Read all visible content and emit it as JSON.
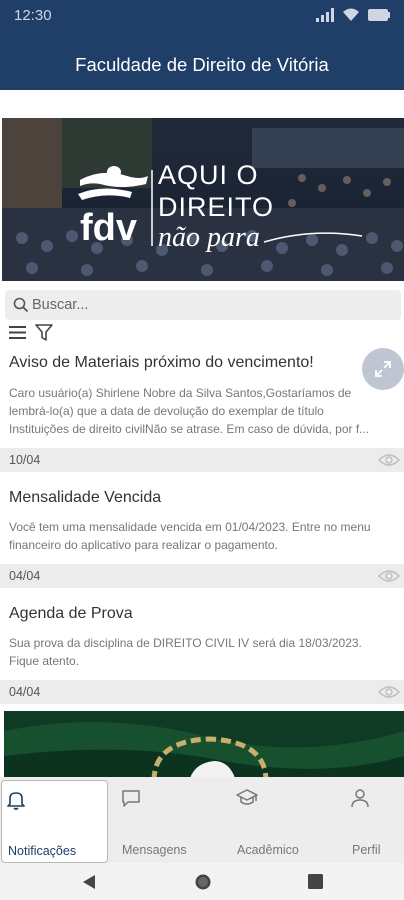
{
  "status": {
    "time": "12:30"
  },
  "app": {
    "title": "Faculdade de Direito de Vitória"
  },
  "banner": {
    "brand": "fdv",
    "slogan_line1": "AQUI O",
    "slogan_line2": "DIREITO",
    "slogan_line3": "não para"
  },
  "search": {
    "placeholder": "Buscar..."
  },
  "notifications": [
    {
      "title": "Aviso de Materiais próximo do vencimento!",
      "body": "Caro usuário(a) Shirlene Nobre da Silva Santos,Gostaríamos de lembrá-lo(a) que a data de devolução do exemplar de título Instituições de direito civilNão se atrase. Em caso de dúvida, por f...",
      "date": "10/04"
    },
    {
      "title": "Mensalidade Vencida",
      "body": "Você tem uma mensalidade vencida em 01/04/2023. Entre no menu financeiro do aplicativo para realizar o pagamento.",
      "date": "04/04"
    },
    {
      "title": "Agenda de Prova",
      "body": "Sua prova da disciplina de DIREITO CIVIL IV será dia 18/03/2023. Fique atento.",
      "date": "04/04"
    }
  ],
  "nav": {
    "tabs": [
      {
        "label": "Notificações",
        "icon": "bell-icon",
        "active": true
      },
      {
        "label": "Mensagens",
        "icon": "chat-icon"
      },
      {
        "label": "Acadêmico",
        "icon": "graduation-cap-icon"
      },
      {
        "label": "Perfil",
        "icon": "person-icon"
      }
    ]
  },
  "colors": {
    "primary": "#1f3e68",
    "background": "#ffffff",
    "surface": "#ededed",
    "text": "#333333",
    "muted": "#777777"
  }
}
